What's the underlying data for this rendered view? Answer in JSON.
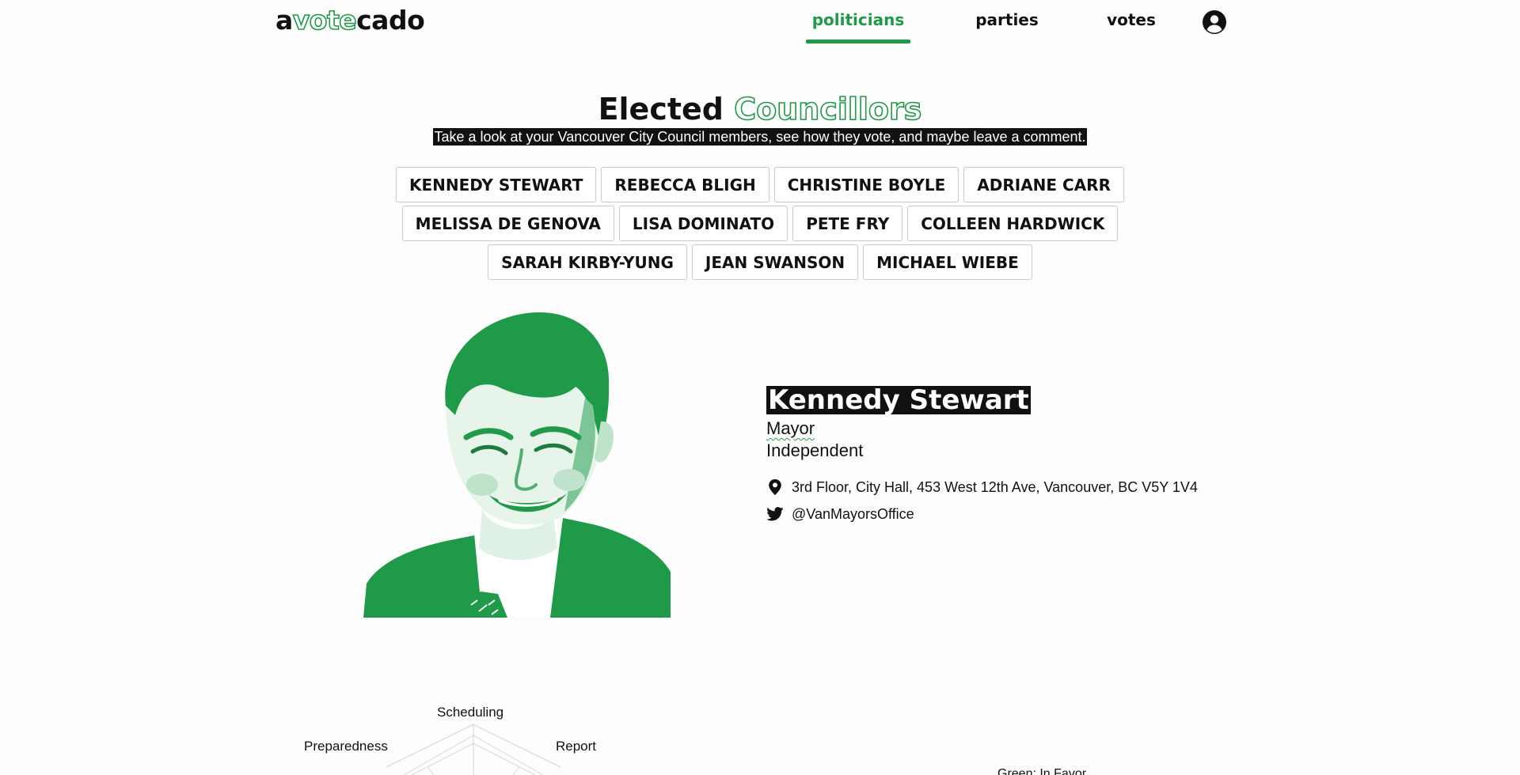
{
  "header": {
    "logo": {
      "pre": "a",
      "highlight": "vote",
      "post": "cado"
    },
    "nav": [
      {
        "label": "politicians",
        "active": true
      },
      {
        "label": "parties",
        "active": false
      },
      {
        "label": "votes",
        "active": false
      }
    ],
    "account_icon": "user-circle-icon",
    "accent_color": "#1e9a48"
  },
  "page": {
    "title_plain": "Elected",
    "title_outline": "Councillors",
    "subtitle": "Take a look at your Vancouver City Council members, see how they vote, and maybe leave a comment."
  },
  "councillors": {
    "row1": [
      "KENNEDY STEWART",
      "REBECCA BLIGH",
      "CHRISTINE BOYLE",
      "ADRIANE CARR"
    ],
    "row2": [
      "MELISSA DE GENOVA",
      "LISA DOMINATO",
      "PETE FRY",
      "COLLEEN HARDWICK"
    ],
    "row3": [
      "SARAH KIRBY-YUNG",
      "JEAN SWANSON",
      "MICHAEL WIEBE"
    ]
  },
  "profile": {
    "name": "Kennedy Stewart",
    "role": "Mayor",
    "party": "Independent",
    "address": "3rd Floor, City Hall, 453 West 12th Ave, Vancouver, BC V5Y 1V4",
    "address_icon": "map-pin-icon",
    "twitter": "@VanMayorsOffice",
    "twitter_icon": "twitter-icon"
  },
  "radar": {
    "labels": {
      "top": "Scheduling",
      "left": "Preparedness",
      "right": "Report"
    }
  },
  "votes_chart": {
    "legend_partial": "Green: In Favor"
  }
}
